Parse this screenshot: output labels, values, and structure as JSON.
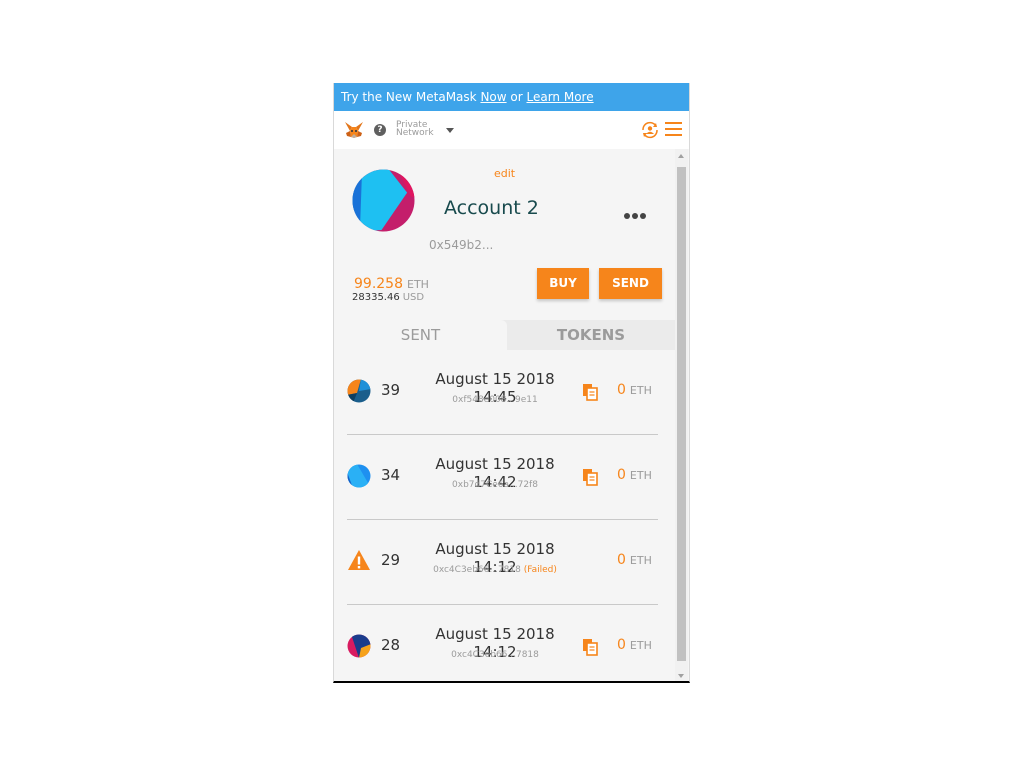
{
  "banner": {
    "text": "Try the New MetaMask ",
    "now_link": "Now",
    "or_text": " or ",
    "learn_link": "Learn More"
  },
  "header": {
    "network_line1": "Private",
    "network_line2": "Network",
    "help_glyph": "?",
    "icons": [
      "metamask-fox-icon",
      "help-icon",
      "chevron-down-icon",
      "account-switch-icon",
      "hamburger-menu-icon"
    ]
  },
  "account": {
    "edit_label": "edit",
    "name": "Account 2",
    "address": "0x549b2...",
    "eth_balance": "99.258",
    "eth_unit": "ETH",
    "usd_balance": "28335.46",
    "usd_unit": "USD",
    "buy_label": "BUY",
    "send_label": "SEND"
  },
  "tabs": {
    "sent": "SENT",
    "tokens": "TOKENS"
  },
  "transactions": [
    {
      "nonce": "39",
      "date": "August 15 2018 14:45",
      "hash": "0xf548e008...9e11",
      "status": "",
      "value": "0",
      "unit": "ETH"
    },
    {
      "nonce": "34",
      "date": "August 15 2018 14:42",
      "hash": "0xb7d7Ce6a...72f8",
      "status": "",
      "value": "0",
      "unit": "ETH"
    },
    {
      "nonce": "29",
      "date": "August 15 2018 14:12",
      "hash": "0xc4C3eb66...7818",
      "status": "(Failed)",
      "value": "0",
      "unit": "ETH"
    },
    {
      "nonce": "28",
      "date": "August 15 2018 14:12",
      "hash": "0xc4C3eb66...7818",
      "status": "",
      "value": "0",
      "unit": "ETH"
    }
  ],
  "colors": {
    "accent": "#f6851b",
    "banner": "#3ea4ea",
    "account_name": "#184a4d"
  }
}
